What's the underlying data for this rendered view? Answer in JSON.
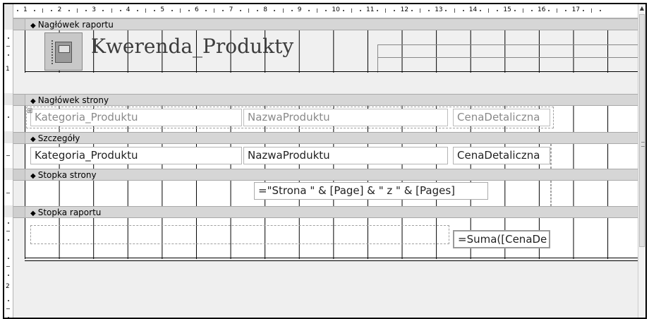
{
  "sections": {
    "report_header": "Nagłówek raportu",
    "page_header": "Nagłówek strony",
    "details": "Szczegóły",
    "page_footer": "Stopka strony",
    "report_footer": "Stopka raportu"
  },
  "report_header": {
    "title": "Kwerenda_Produkty",
    "logo_icon": "report-book-icon"
  },
  "page_header": {
    "labels": [
      "Kategoria_Produktu",
      "NazwaProduktu",
      "CenaDetaliczna"
    ]
  },
  "details": {
    "textboxes": [
      "Kategoria_Produktu",
      "NazwaProduktu",
      "CenaDetaliczna"
    ]
  },
  "page_footer": {
    "page_expr": "=\"Strona \" & [Page] & \" z \" & [Pages]"
  },
  "report_footer": {
    "sum_expr": "=Suma([CenaDe"
  },
  "ruler": {
    "h_numbers": [
      "1",
      "2",
      "3",
      "4",
      "5",
      "6",
      "7",
      "8",
      "9",
      "10",
      "11",
      "12",
      "13",
      "14",
      "15",
      "16",
      "17"
    ],
    "v_numbers": [
      "1",
      "2"
    ]
  }
}
